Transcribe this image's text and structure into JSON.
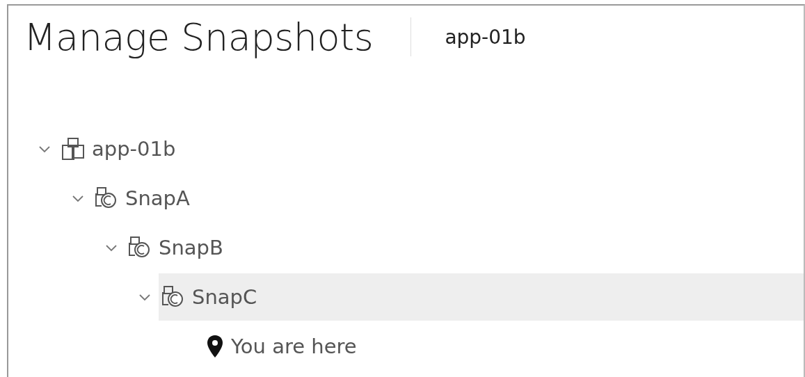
{
  "header": {
    "title": "Manage Snapshots",
    "vm_name": "app-01b"
  },
  "tree": [
    {
      "label": "app-01b",
      "kind": "vm",
      "expanded": true,
      "selected": false,
      "children": [
        {
          "label": "SnapA",
          "kind": "snapshot",
          "expanded": true,
          "selected": false,
          "children": [
            {
              "label": "SnapB",
              "kind": "snapshot",
              "expanded": true,
              "selected": false,
              "children": [
                {
                  "label": "SnapC",
                  "kind": "snapshot",
                  "expanded": true,
                  "selected": true,
                  "children": [
                    {
                      "label": "You are here",
                      "kind": "current",
                      "selected": false
                    }
                  ]
                }
              ]
            }
          ]
        }
      ]
    }
  ]
}
